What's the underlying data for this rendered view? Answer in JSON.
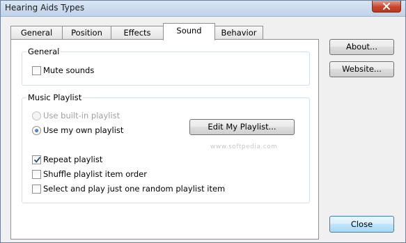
{
  "window": {
    "title": "Hearing Aids Types"
  },
  "tabs": [
    {
      "label": "General",
      "active": false
    },
    {
      "label": "Position",
      "active": false
    },
    {
      "label": "Effects",
      "active": false
    },
    {
      "label": "Sound",
      "active": true
    },
    {
      "label": "Behavior",
      "active": false
    }
  ],
  "general_group": {
    "label": "General",
    "mute_sounds": {
      "label": "Mute sounds",
      "checked": false
    }
  },
  "playlist_group": {
    "label": "Music Playlist",
    "use_builtin": {
      "label": "Use built-in playlist",
      "selected": false,
      "disabled": true
    },
    "use_own": {
      "label": "Use my own playlist",
      "selected": true
    },
    "edit_button": "Edit My Playlist...",
    "repeat": {
      "label": "Repeat playlist",
      "checked": true
    },
    "shuffle": {
      "label": "Shuffle playlist item order",
      "checked": false
    },
    "random_one": {
      "label": "Select and play just one random playlist item",
      "checked": false
    }
  },
  "side_buttons": {
    "about": "About...",
    "website": "Website...",
    "close": "Close"
  },
  "watermark_text": "www.softpedia.com",
  "colors": {
    "close_button_red": "#c9452b",
    "focus_blue": "#3c7fb1",
    "radio_dot_blue": "#1d4f97"
  }
}
